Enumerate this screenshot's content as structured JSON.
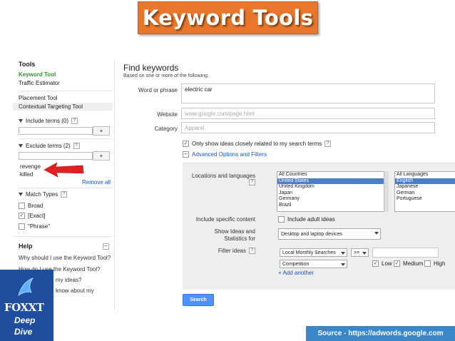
{
  "banner": {
    "title": "Keyword Tools"
  },
  "sidebar": {
    "tools_title": "Tools",
    "items": [
      "Keyword Tool",
      "Traffic Estimator",
      "Placement Tool",
      "Contextual Targeting Tool"
    ],
    "include_terms": "Include terms (0)",
    "exclude_terms": "Exclude terms (2)",
    "excluded": [
      "revenge",
      "killed"
    ],
    "remove_all": "Remove all",
    "match_types": "Match Types",
    "match_options": [
      {
        "label": "Broad",
        "checked": false
      },
      {
        "label": "[Exact]",
        "checked": true
      },
      {
        "label": "\"Phrase\"",
        "checked": false
      }
    ],
    "help_title": "Help",
    "help_links": [
      "Why should I use the Keyword Tool?",
      "How do I use the Keyword Tool?",
      "my ideas?",
      "know about my"
    ],
    "plus": "+",
    "q": "?",
    "minus": "–"
  },
  "main": {
    "title": "Find keywords",
    "subtitle": "Based on one or more of the following:",
    "word_label": "Word or phrase",
    "word_value": "electric car",
    "website_label": "Website",
    "website_placeholder": "www.google.com/page.html",
    "category_label": "Category",
    "category_placeholder": "Apparel",
    "only_show": "Only show ideas closely related to my search terms",
    "advanced": "Advanced Options and Filters",
    "search_button": "Search"
  },
  "advanced": {
    "locations_label": "Locations and languages",
    "countries": [
      "All Countries",
      "United States",
      "United Kingdom",
      "Japan",
      "Germany",
      "Brazil"
    ],
    "selected_country": "United States",
    "languages": [
      "All Languages",
      "English",
      "Japanese",
      "German",
      "Portuguese"
    ],
    "selected_language": "English",
    "specific_label": "Include specific content",
    "adult_label": "Include adult ideas",
    "show_ideas_label_1": "Show Ideas and",
    "show_ideas_label_2": "Statistics for",
    "devices": "Desktop and laptop devices",
    "filter_label": "Filter ideas",
    "filter_metric": "Local Monthly Searches",
    "filter_op": ">=",
    "competition": "Competition",
    "competition_levels": [
      {
        "label": "Low",
        "checked": true
      },
      {
        "label": "Medium",
        "checked": true
      },
      {
        "label": "High",
        "checked": false
      }
    ],
    "add_another": "+ Add another"
  },
  "logo": {
    "brand": "FOXXT",
    "line1": "Deep",
    "line2": "Dive"
  },
  "footer": {
    "source": "Source - https://adwords.google.com"
  },
  "colors": {
    "banner": "#e8762b",
    "link": "#1155cc",
    "tool_active": "#3a8b3a",
    "search_button": "#4d90fe",
    "source_bar": "#3a86c9",
    "arrow": "#e02020"
  }
}
